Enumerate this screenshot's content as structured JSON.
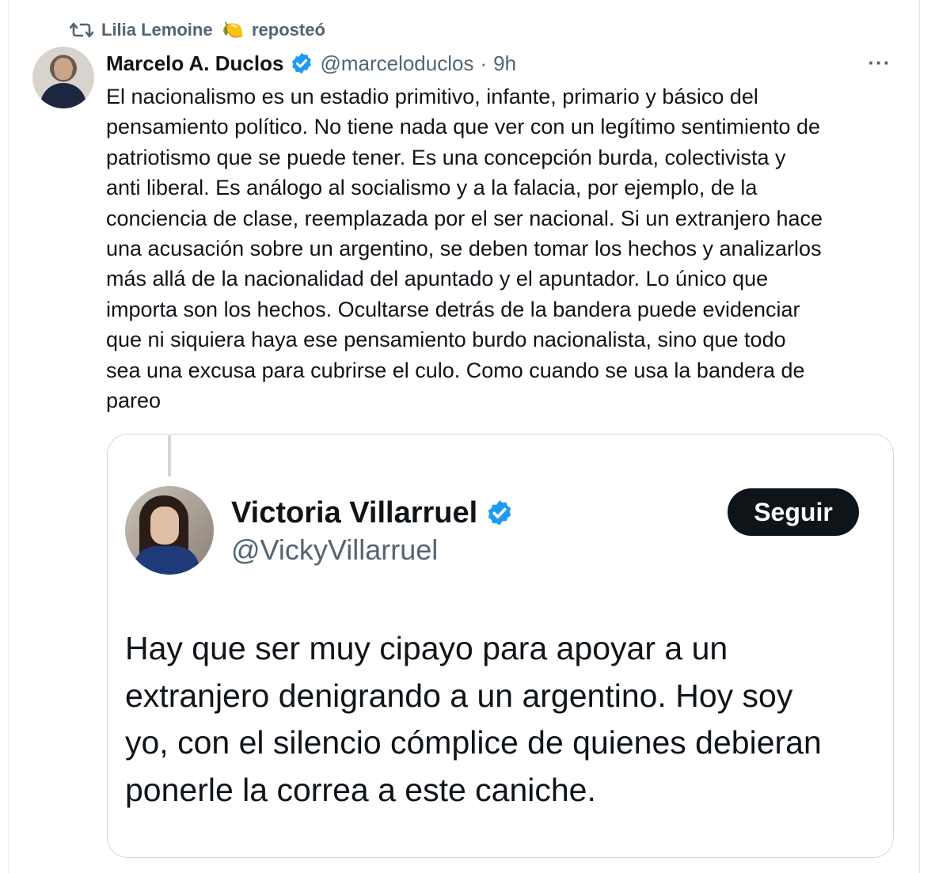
{
  "repost": {
    "user": "Lilia Lemoine",
    "emoji": "🍋",
    "action": "reposteó"
  },
  "tweet": {
    "author_name": "Marcelo A. Duclos",
    "handle": "@marceloduclos",
    "separator": "·",
    "time": "9h",
    "more": "···",
    "text": "El nacionalismo es un estadio primitivo, infante, primario y básico del\npensamiento político. No tiene nada que ver con un legítimo sentimiento de\npatriotismo que se puede tener. Es una concepción burda, colectivista y\nanti liberal. Es análogo al socialismo y a la falacia, por ejemplo, de la\nconciencia de clase, reemplazada por el ser nacional. Si un extranjero hace\nuna acusación sobre un argentino, se deben tomar los hechos y analizarlos\nmás allá de la nacionalidad del apuntado y el apuntador. Lo único que\nimporta son los hechos. Ocultarse detrás de la bandera puede evidenciar\nque ni siquiera haya ese pensamiento burdo nacionalista, sino que todo\nsea una excusa para cubrirse el culo. Como cuando se usa la bandera de\npareo"
  },
  "quoted": {
    "author_name": "Victoria Villarruel",
    "handle": "@VickyVillarruel",
    "follow_label": "Seguir",
    "text": "Hay que ser muy cipayo para apoyar a un\nextranjero denigrando a un argentino. Hoy soy\nyo, con el silencio cómplice de quienes debieran\nponerle la correa a este caniche."
  },
  "colors": {
    "text_primary": "#0f1419",
    "text_secondary": "#536471",
    "verified_blue": "#1d9bf0",
    "border": "#cfd9de"
  },
  "icons": {
    "repost": "repost-icon",
    "verified": "verified-badge-icon",
    "more": "more-options-icon"
  }
}
